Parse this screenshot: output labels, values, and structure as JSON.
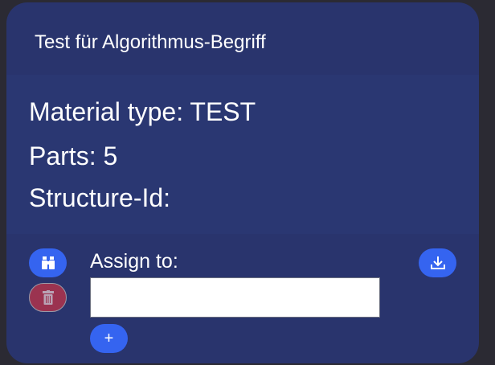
{
  "card": {
    "title": "Test für Algorithmus-Begriff",
    "material_type": "Material type: TEST",
    "parts": "Parts: 5",
    "structure_id": "Structure-Id:",
    "assign_label": "Assign to:",
    "assign_value": "",
    "add_label": "+"
  },
  "colors": {
    "primary": "#3564f0",
    "danger": "#9b3350",
    "card": "#29346d"
  }
}
